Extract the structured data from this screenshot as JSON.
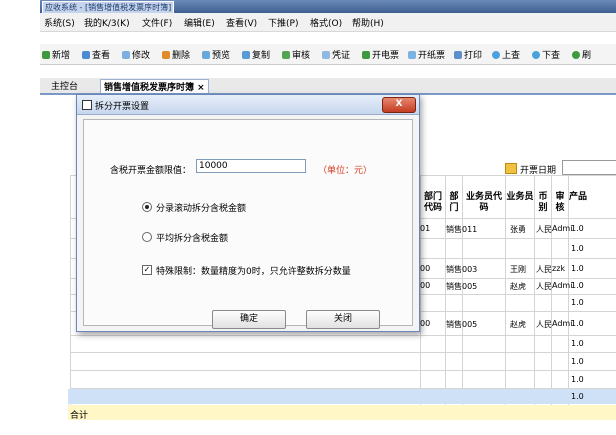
{
  "window": {
    "title": "应收系统 - [销售增值税发票序时簿]"
  },
  "menu": [
    "系统(S)",
    "我的K/3(K)",
    "文件(F)",
    "编辑(E)",
    "查看(V)",
    "下推(P)",
    "格式(O)",
    "帮助(H)"
  ],
  "toolbar": [
    "新增",
    "查看",
    "修改",
    "删除",
    "预览",
    "复制",
    "审核",
    "凭证",
    "开电票",
    "开纸票",
    "打印",
    "上查",
    "下查",
    "刷"
  ],
  "tabs": {
    "home": "主控台",
    "active": "销售增值税发票序时簿 ×"
  },
  "background": {
    "filter_label": "开票日期",
    "headers": [
      "部门代码",
      "部门",
      "业务员代码",
      "业务员",
      "币别",
      "审核",
      "产品"
    ],
    "rows": [
      [
        "01",
        "销售011",
        "张勇",
        "人民",
        "Admi",
        "1.0"
      ],
      [
        "00",
        "销售003",
        "王刚",
        "人民",
        "zzk",
        "1.0"
      ],
      [
        "00",
        "销售005",
        "赵虎",
        "人民",
        "Admi",
        "1.0"
      ],
      [
        "00",
        "销售005",
        "赵虎",
        "人民",
        "Admi",
        "1.0"
      ]
    ],
    "sub_value": "1.0",
    "total_label": "合计"
  },
  "dialog": {
    "title": "拆分开票设置",
    "close_label": "X",
    "limit_label": "含税开票金额限值：",
    "limit_value": "10000",
    "unit_label": "（单位：元）",
    "option_rolling": "分录滚动拆分含税金额",
    "option_average": "平均拆分含税金额",
    "special_label": "特殊限制：数量精度为0时，只允许整数拆分数量",
    "ok_label": "确定",
    "cancel_label": "关闭"
  },
  "colors": {
    "accent": "#3e5f92",
    "unit_red": "#d83a1e",
    "total_row": "#fff7c6"
  }
}
